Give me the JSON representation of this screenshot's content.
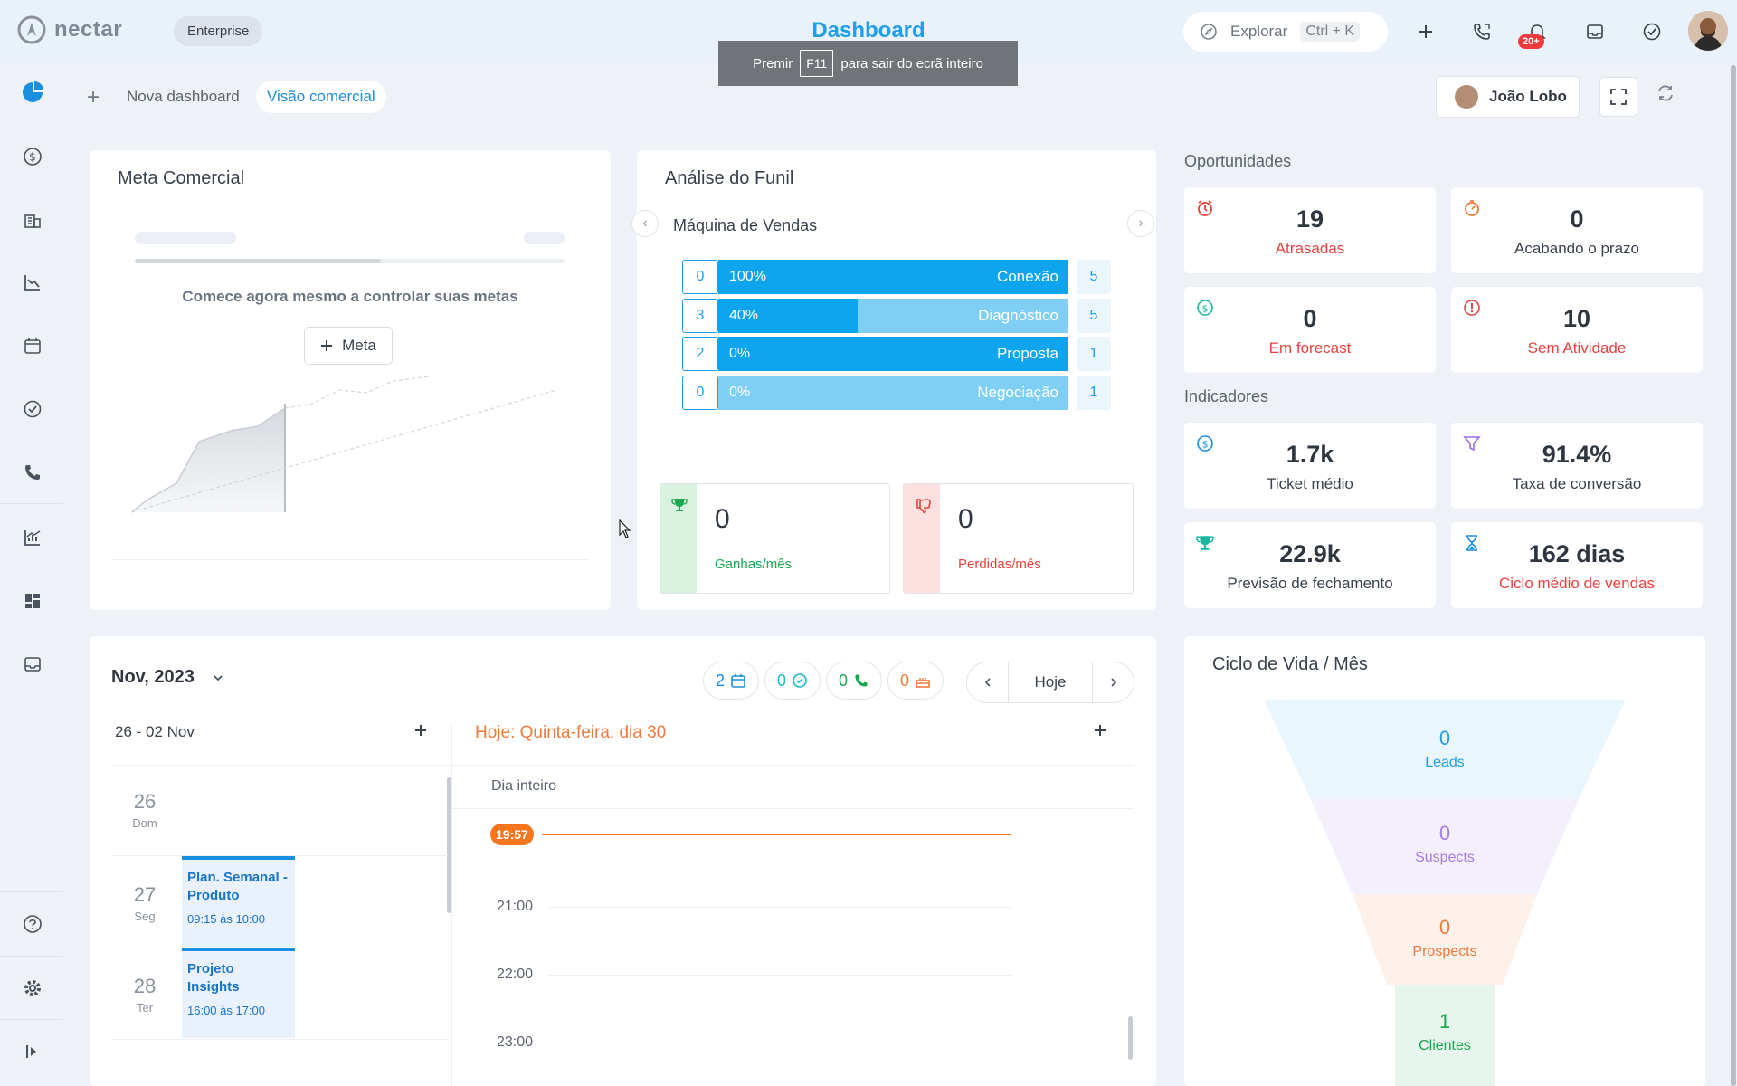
{
  "app": {
    "logo": "nectar",
    "plan": "Enterprise",
    "title": "Dashboard"
  },
  "search": {
    "label": "Explorar",
    "shortcut": "Ctrl + K"
  },
  "notifications": {
    "badge": "20+"
  },
  "fullscreen_hint": {
    "prefix": "Premir",
    "key": "F11",
    "suffix": "para sair do ecrã inteiro"
  },
  "tabs": {
    "add_label": "Nova dashboard",
    "active_label": "Visão comercial"
  },
  "user": {
    "name": "João Lobo"
  },
  "meta": {
    "title": "Meta Comercial",
    "empty_text": "Comece agora mesmo a controlar suas metas",
    "button_label": "Meta"
  },
  "funnel": {
    "title": "Análise do Funil",
    "pipeline": "Máquina de Vendas",
    "stages": [
      {
        "left": "0",
        "pct": "100%",
        "pct_value": 100,
        "name": "Conexão",
        "right": "5"
      },
      {
        "left": "3",
        "pct": "40%",
        "pct_value": 40,
        "name": "Diagnóstico",
        "right": "5"
      },
      {
        "left": "2",
        "pct": "0%",
        "pct_value": 0,
        "name": "Proposta",
        "right": "1"
      },
      {
        "left": "0",
        "pct": "0%",
        "pct_value": 0,
        "name": "Negociação",
        "right": "1"
      }
    ],
    "won": {
      "value": "0",
      "label": "Ganhas/mês"
    },
    "lost": {
      "value": "0",
      "label": "Perdidas/mês"
    }
  },
  "opportunities": {
    "title": "Oportunidades",
    "items": [
      {
        "value": "19",
        "label": "Atrasadas",
        "icon": "alarm-icon",
        "color": "#e8423f"
      },
      {
        "value": "0",
        "label": "Acabando o prazo",
        "icon": "timer-icon",
        "color": "#3a424d"
      },
      {
        "value": "0",
        "label": "Em forecast",
        "icon": "dollar-icon",
        "color": "#e8423f"
      },
      {
        "value": "10",
        "label": "Sem Atividade",
        "icon": "alert-icon",
        "color": "#e8423f"
      }
    ]
  },
  "indicators": {
    "title": "Indicadores",
    "items": [
      {
        "value": "1.7k",
        "label": "Ticket médio",
        "icon": "dollar-icon",
        "color": "#3a424d"
      },
      {
        "value": "91.4%",
        "label": "Taxa de conversão",
        "icon": "filter-icon",
        "color": "#3a424d"
      },
      {
        "value": "22.9k",
        "label": "Previsão de fechamento",
        "icon": "trophy-icon",
        "color": "#3a424d"
      },
      {
        "value": "162 dias",
        "label": "Ciclo médio de vendas",
        "icon": "hourglass-icon",
        "color": "#e8423f"
      }
    ]
  },
  "calendar": {
    "month": "Nov, 2023",
    "counters": [
      {
        "value": "2",
        "icon": "calendar-icon",
        "color": "#1a8fe0"
      },
      {
        "value": "0",
        "icon": "check-icon",
        "color": "#1ab7c4"
      },
      {
        "value": "0",
        "icon": "phone-icon",
        "color": "#1aa84f"
      },
      {
        "value": "0",
        "icon": "cake-icon",
        "color": "#f07a3c"
      }
    ],
    "today_button": "Hoje",
    "week_range": "26 - 02 Nov",
    "today_label": "Hoje: Quinta-feira, dia 30",
    "days": [
      {
        "num": "26",
        "weekday": "Dom"
      },
      {
        "num": "27",
        "weekday": "Seg"
      },
      {
        "num": "28",
        "weekday": "Ter"
      }
    ],
    "events": [
      {
        "title": "Plan. Semanal - Produto",
        "time": "09:15 às 10:00"
      },
      {
        "title": "Projeto Insights",
        "time": "16:00 às 17:00"
      }
    ],
    "all_day": "Dia inteiro",
    "now": "19:57",
    "hours": [
      "21:00",
      "22:00",
      "23:00"
    ]
  },
  "lifecycle": {
    "title": "Ciclo de Vida / Mês",
    "stages": [
      {
        "value": "0",
        "label": "Leads",
        "color": "#1ea0e8"
      },
      {
        "value": "0",
        "label": "Suspects",
        "color": "#a67be3"
      },
      {
        "value": "0",
        "label": "Prospects",
        "color": "#f07a3c"
      },
      {
        "value": "1",
        "label": "Clientes",
        "color": "#1aa84f"
      }
    ]
  }
}
